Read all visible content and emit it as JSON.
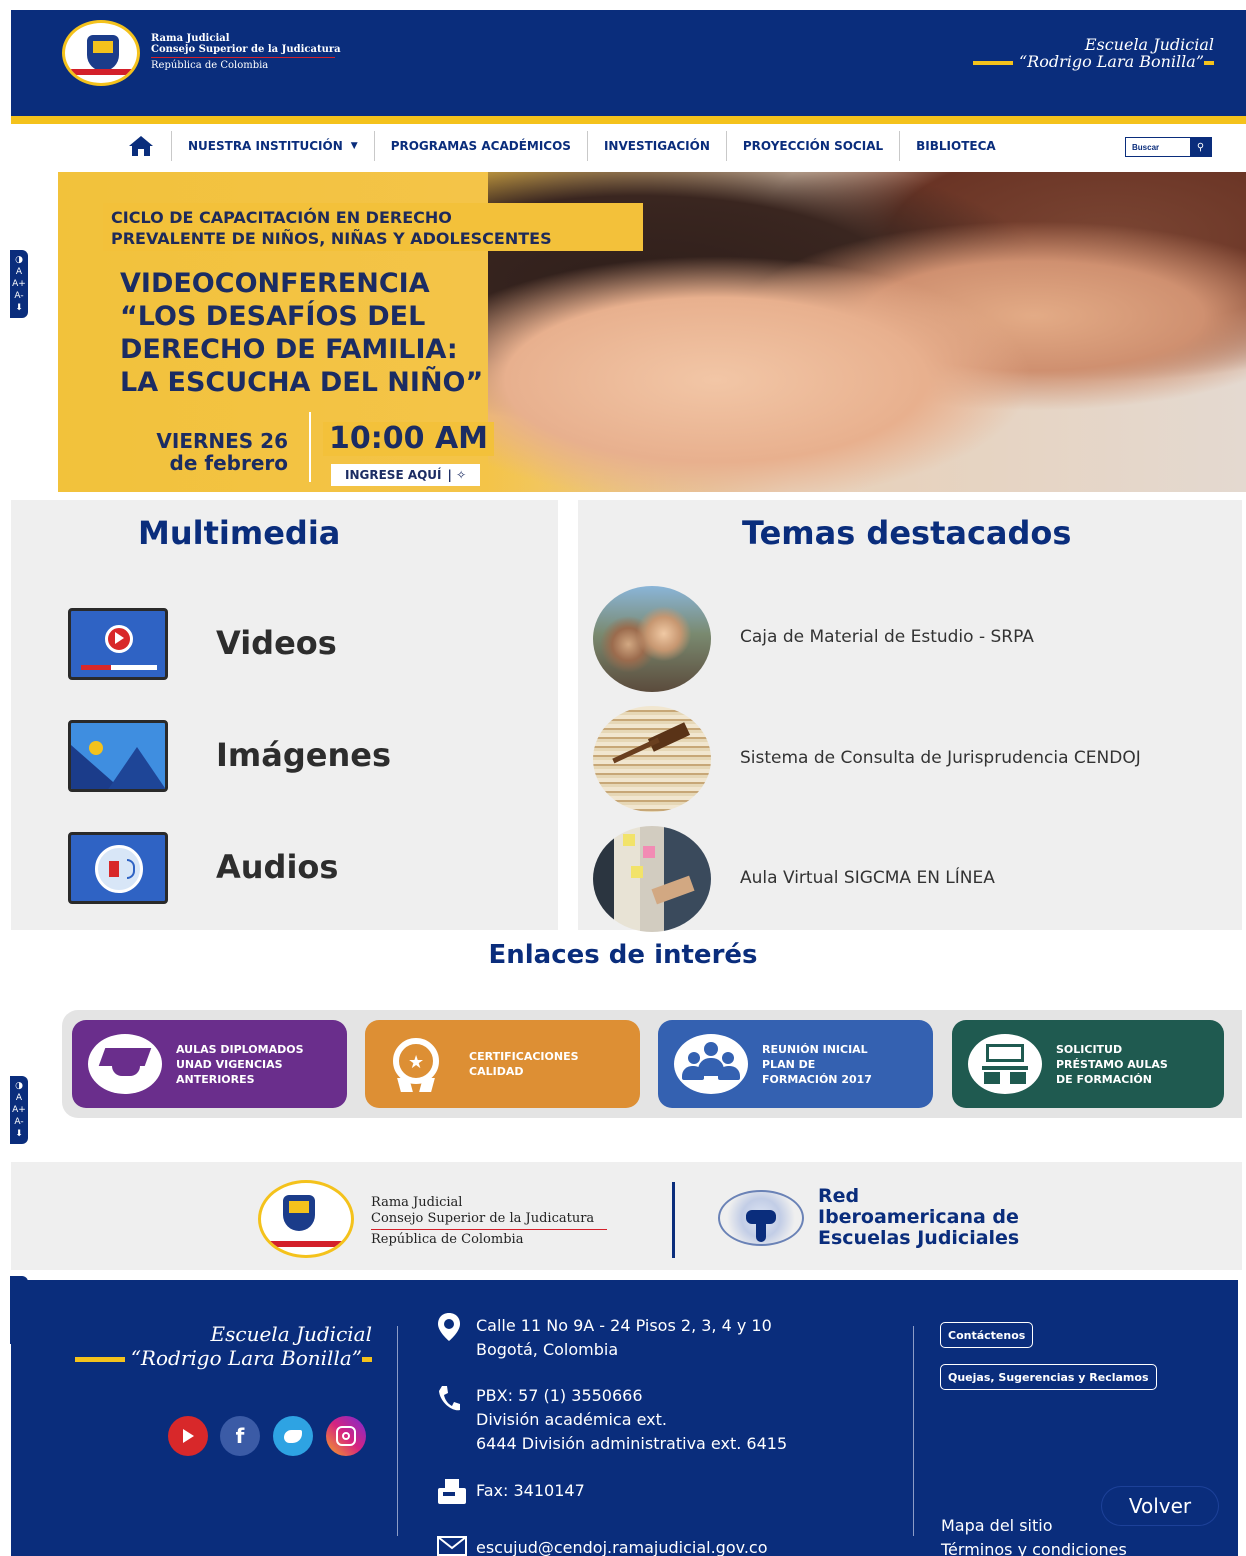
{
  "header": {
    "line1": "Rama Judicial",
    "line2": "Consejo Superior de la Judicatura",
    "line3": "República de Colombia",
    "school_line1": "Escuela Judicial",
    "school_line2": "“Rodrigo Lara Bonilla”"
  },
  "nav": {
    "items": [
      {
        "label": "NUESTRA INSTITUCIÓN",
        "has_dropdown": true
      },
      {
        "label": "PROGRAMAS ACADÉMICOS"
      },
      {
        "label": "INVESTIGACIÓN"
      },
      {
        "label": "PROYECCIÓN SOCIAL"
      },
      {
        "label": "BIBLIOTECA"
      }
    ],
    "search_placeholder": "Buscar"
  },
  "banner": {
    "cycle_line1": "CICLO DE CAPACITACIÓN EN DERECHO",
    "cycle_line2": "PREVALENTE DE NIÑOS, NIÑAS Y ADOLESCENTES",
    "title_line1": "VIDEOCONFERENCIA",
    "title_line2": "“LOS DESAFÍOS DEL",
    "title_line3": "DERECHO DE FAMILIA:",
    "title_line4": "LA ESCUCHA DEL NIÑO”",
    "date_line1": "VIERNES 26",
    "date_line2": "de febrero",
    "time": "10:00 AM",
    "cta": "INGRESE AQUÍ"
  },
  "accessibility": {
    "contrast": "◑",
    "a": "A",
    "a_plus": "A+",
    "a_minus": "A-",
    "download": "⬇"
  },
  "multimedia": {
    "title": "Multimedia",
    "items": [
      {
        "label": "Videos"
      },
      {
        "label": "Imágenes"
      },
      {
        "label": "Audios"
      }
    ]
  },
  "featured": {
    "title": "Temas destacados",
    "items": [
      {
        "label": "Caja de Material de Estudio - SRPA"
      },
      {
        "label": "Sistema de Consulta de Jurisprudencia CENDOJ"
      },
      {
        "label": "Aula Virtual SIGCMA EN LÍNEA"
      }
    ]
  },
  "links": {
    "title": "Enlaces de interés",
    "cards": [
      {
        "line1": "AULAS DIPLOMADOS",
        "line2": "UNAD VIGENCIAS",
        "line3": "ANTERIORES",
        "color": "#6a2e8c"
      },
      {
        "line1": "CERTIFICACIONES",
        "line2": "CALIDAD",
        "line3": "",
        "color": "#dd8f34"
      },
      {
        "line1": "REUNIÓN INICIAL",
        "line2": "PLAN DE",
        "line3": "FORMACIÓN 2017",
        "color": "#3461b1"
      },
      {
        "line1": "SOLICITUD",
        "line2": "PRÉSTAMO AULAS",
        "line3": "DE FORMACIÓN",
        "color": "#1f5a50"
      }
    ]
  },
  "partners": {
    "line1": "Rama Judicial",
    "line2": "Consejo Superior de la Judicatura",
    "line3": "República de Colombia",
    "red_line1": "Red",
    "red_line2": "Iberoamericana de",
    "red_line3": "Escuelas Judiciales"
  },
  "footer": {
    "school_line1": "Escuela Judicial",
    "school_line2": "“Rodrigo Lara Bonilla”",
    "address_line1": "Calle 11 No 9A - 24 Pisos 2, 3, 4 y 10",
    "address_line2": "Bogotá, Colombia",
    "phone_line1": "PBX: 57 (1) 3550666",
    "phone_line2": "División académica ext.",
    "phone_line3": "6444 División administrativa ext. 6415",
    "fax": "Fax: 3410147",
    "email": "escujud@cendoj.ramajudicial.gov.co",
    "contact_button": "Contáctenos",
    "complaints_button": "Quejas, Sugerencias y Reclamos",
    "sitemap": "Mapa del sitio",
    "terms": "Términos y condiciones",
    "back_button": "Volver"
  },
  "colors": {
    "primary": "#0a2d7c",
    "accent": "#f4c21c",
    "youtube": "#d8282a",
    "facebook": "#3b5ba6",
    "twitter": "#2ea3e3",
    "instagram": "#d6247f"
  }
}
